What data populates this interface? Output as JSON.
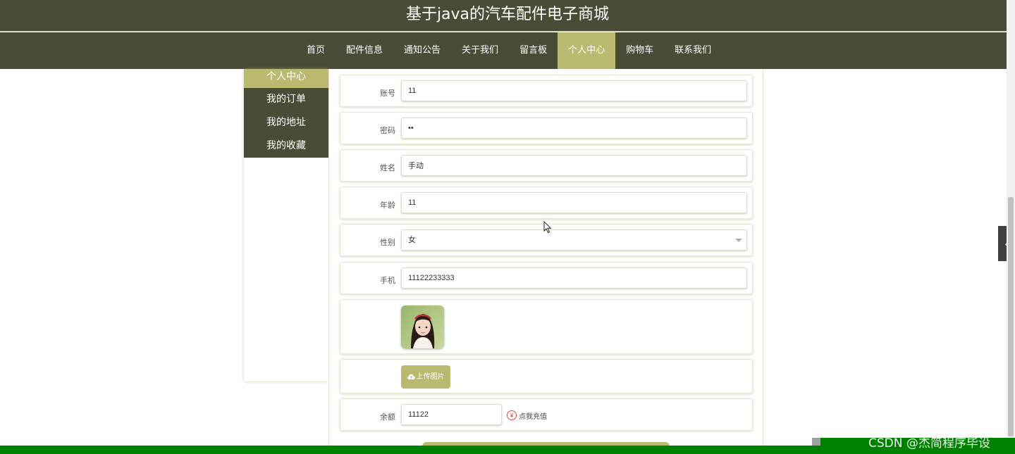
{
  "header": {
    "title": "基于java的汽车配件电子商城"
  },
  "nav": {
    "items": [
      {
        "label": "首页",
        "active": false
      },
      {
        "label": "配件信息",
        "active": false
      },
      {
        "label": "通知公告",
        "active": false
      },
      {
        "label": "关于我们",
        "active": false
      },
      {
        "label": "留言板",
        "active": false
      },
      {
        "label": "个人中心",
        "active": true
      },
      {
        "label": "购物车",
        "active": false
      },
      {
        "label": "联系我们",
        "active": false
      }
    ]
  },
  "sidebar": {
    "items": [
      {
        "label": "个人中心",
        "active": true
      },
      {
        "label": "我的订单",
        "active": false
      },
      {
        "label": "我的地址",
        "active": false
      },
      {
        "label": "我的收藏",
        "active": false
      }
    ]
  },
  "form": {
    "account": {
      "label": "账号",
      "value": "11"
    },
    "password": {
      "label": "密码",
      "value": "••"
    },
    "name": {
      "label": "姓名",
      "value": "手动"
    },
    "age": {
      "label": "年龄",
      "value": "11"
    },
    "gender": {
      "label": "性别",
      "value": "女"
    },
    "phone": {
      "label": "手机",
      "value": "11122233333"
    },
    "upload": {
      "label": "上传图片"
    },
    "balance": {
      "label": "余额",
      "value": "11122",
      "recharge_label": "点我充值",
      "currency_symbol": "¥"
    }
  },
  "watermark": "CSDN @杰简程序毕设",
  "colors": {
    "header_bg": "#4b4c38",
    "accent": "#b9b970",
    "status_bar": "#008000"
  },
  "icons": {
    "upload": "cloud-upload-icon",
    "recharge": "yuan-icon",
    "toggle": "chevron-left-icon",
    "select": "chevron-down-icon"
  }
}
